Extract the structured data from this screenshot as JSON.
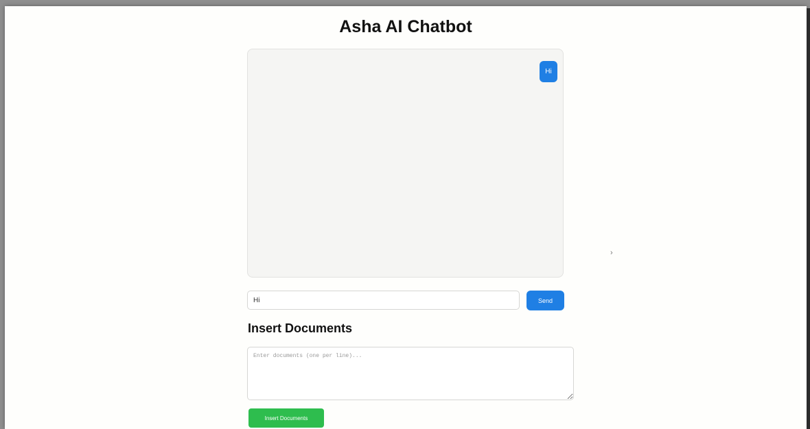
{
  "page": {
    "title": "Asha AI Chatbot"
  },
  "chat": {
    "messages": [
      {
        "role": "user",
        "text": "Hi"
      }
    ]
  },
  "message_input": {
    "value": "Hi"
  },
  "send_button": {
    "label": "Send"
  },
  "documents": {
    "heading": "Insert Documents",
    "placeholder": "Enter documents (one per line)...",
    "button_label": "Insert Documents"
  },
  "colors": {
    "accent_blue": "#1f7fe4",
    "accent_green": "#2ebd4e"
  }
}
